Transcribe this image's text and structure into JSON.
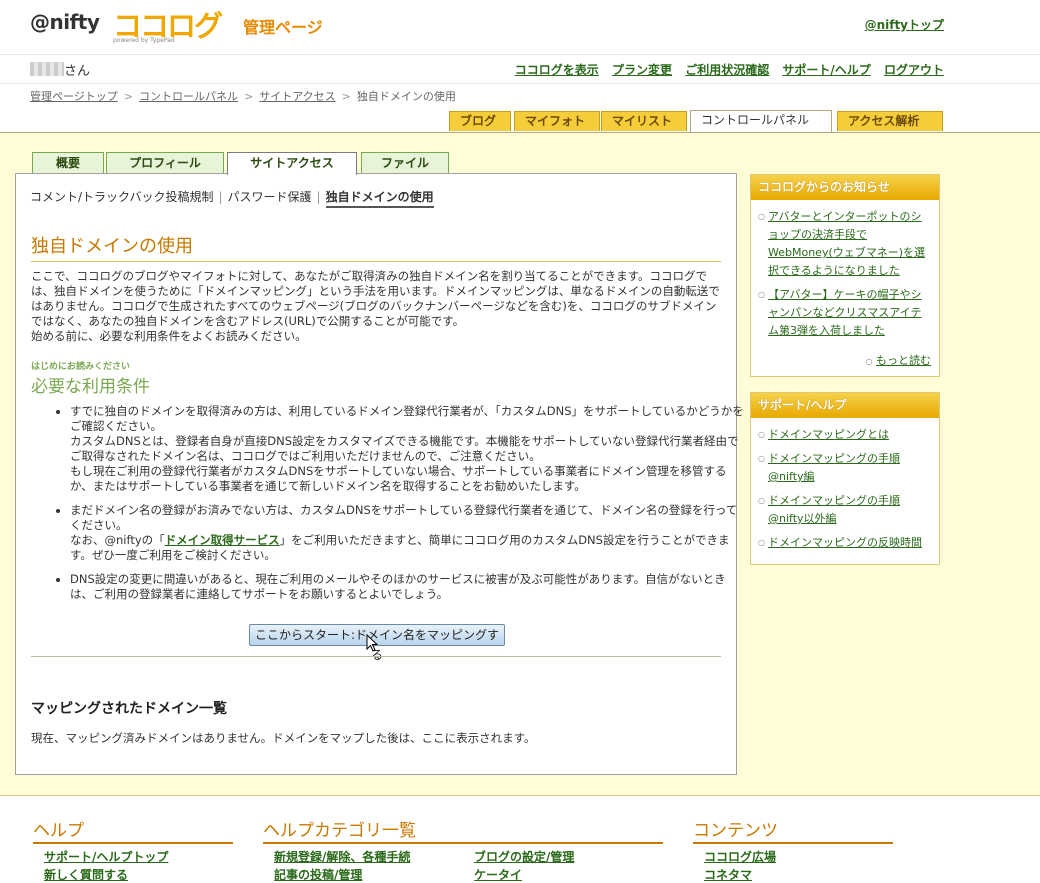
{
  "header": {
    "logo_text": "@nifty",
    "brand": "ココログ",
    "brand_sub": "powered by TypePad",
    "section_title": "管理ページ",
    "top_link": "@niftyトップ"
  },
  "user_bar": {
    "honorific": "さん",
    "links": [
      "ココログを表示",
      "プラン変更",
      "ご利用状況確認",
      "サポート/ヘルプ",
      "ログアウト"
    ]
  },
  "breadcrumb": [
    "管理ページトップ",
    "コントロールパネル",
    "サイトアクセス",
    "独自ドメインの使用"
  ],
  "main_tabs": [
    "ブログ",
    "マイフォト",
    "マイリスト",
    "コントロールパネル",
    "アクセス解析"
  ],
  "sub_tabs": [
    "概要",
    "プロフィール",
    "サイトアクセス",
    "ファイル"
  ],
  "sub_nav": [
    "コメント/トラックバック投稿規制",
    "パスワード保護",
    "独自ドメインの使用"
  ],
  "page": {
    "title": "独自ドメインの使用",
    "intro": "ここで、ココログのブログやマイフォトに対して、あなたがご取得済みの独自ドメイン名を割り当てることができます。ココログでは、独自ドメインを使うために「ドメインマッピング」という手法を用います。ドメインマッピングは、単なるドメインの自動転送ではありません。ココログで生成されたすべてのウェブページ(ブログのバックナンバーページなどを含む)を、ココログのサブドメインではなく、あなたの独自ドメインを含むアドレス(URL)で公開することが可能です。",
    "intro2": "始める前に、必要な利用条件をよくお読みください。",
    "kicker": "はじめにお読みください",
    "requirements_title": "必要な利用条件",
    "req1_a": "すでに独自のドメインを取得済みの方は、利用しているドメイン登録代行業者が、「カスタムDNS」をサポートしているかどうかをご確認ください。",
    "req1_b": "カスタムDNSとは、登録者自身が直接DNS設定をカスタマイズできる機能です。本機能をサポートしていない登録代行業者経由でご取得なされたドメイン名は、ココログではご利用いただけませんので、ご注意ください。",
    "req1_c": "もし現在ご利用の登録代行業者がカスタムDNSをサポートしていない場合、サポートしている事業者にドメイン管理を移管するか、またはサポートしている事業者を通じて新しいドメイン名を取得することをお勧めいたします。",
    "req2_a": "まだドメイン名の登録がお済みでない方は、カスタムDNSをサポートしている登録代行業者を通じて、ドメイン名の登録を行ってください。",
    "req2_b_pre": "なお、@niftyの「",
    "req2_link": "ドメイン取得サービス",
    "req2_b_post": "」をご利用いただきますと、簡単にココログ用のカスタムDNS設定を行うことができます。ぜひ一度ご利用をご検討ください。",
    "req3": "DNS設定の変更に間違いがあると、現在ご利用のメールやそのほかのサービスに被害が及ぶ可能性があります。自信がないときは、ご利用の登録業者に連絡してサポートをお願いするとよいでしょう。",
    "start_button": "ここからスタート:ドメイン名をマッピングする",
    "mapped_title": "マッピングされたドメイン一覧",
    "mapped_empty": "現在、マッピング済みドメインはありません。ドメインをマップした後は、ここに表示されます。"
  },
  "sidebar": {
    "news_title": "ココログからのお知らせ",
    "news": [
      "アバターとインターポットのショップの決済手段でWebMoney(ウェブマネー)を選択できるようになりました",
      "【アバター】ケーキの帽子やシャンパンなどクリスマスアイテム第3弾を入荷しました"
    ],
    "more": "もっと読む",
    "support_title": "サポート/ヘルプ",
    "support": [
      "ドメインマッピングとは",
      "ドメインマッピングの手順 @nifty編",
      "ドメインマッピングの手順 @nifty以外編",
      "ドメインマッピングの反映時間"
    ]
  },
  "footer": {
    "help_title": "ヘルプ",
    "help_links": [
      "サポート/ヘルプトップ",
      "新しく質問する"
    ],
    "cat_title": "ヘルプカテゴリ一覧",
    "cat_links": [
      "新規登録/解除、各種手続",
      "記事の投稿/管理",
      "ブログの設定/管理",
      "ケータイ"
    ],
    "content_title": "コンテンツ",
    "content_links": [
      "ココログ広場",
      "コネタマ"
    ]
  },
  "colors": {
    "accent": "#f0a800",
    "link": "#2a6a1a",
    "bg_canvas": "#fffdd8",
    "heading_green": "#7aa850"
  }
}
